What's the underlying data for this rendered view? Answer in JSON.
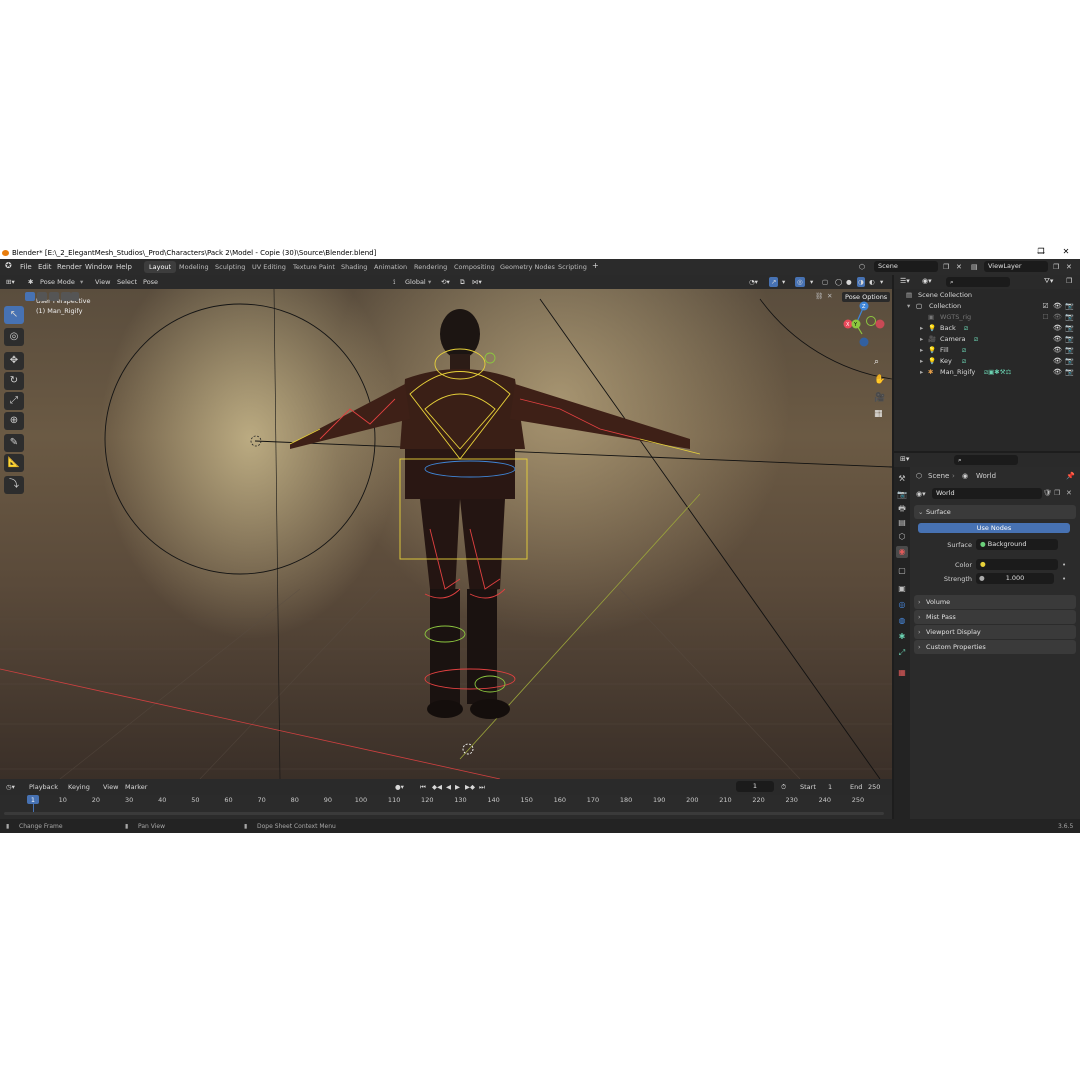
{
  "window": {
    "title": "Blender* [E:\\_2_ElegantMesh_Studios\\_Prod\\Characters\\Pack 2\\Model - Copie (30)\\Source\\Blender.blend]",
    "controls": [
      "—",
      "❐",
      "✕"
    ]
  },
  "menubar": {
    "items": [
      "File",
      "Edit",
      "Render",
      "Window",
      "Help"
    ],
    "workspaces": [
      "Layout",
      "Modeling",
      "Sculpting",
      "UV Editing",
      "Texture Paint",
      "Shading",
      "Animation",
      "Rendering",
      "Compositing",
      "Geometry Nodes",
      "Scripting"
    ],
    "active_workspace": "Layout",
    "add_tab": "+",
    "scene": "Scene",
    "view_layer": "ViewLayer"
  },
  "viewport_header": {
    "mode": "Pose Mode",
    "menus": [
      "View",
      "Select",
      "Pose"
    ],
    "transform_orientation": "Global",
    "pose_options": "Pose Options"
  },
  "viewport": {
    "perspective_label": "User Perspective",
    "object_label": "(1) Man_Rigify",
    "gizmo_axes": [
      "X",
      "Y",
      "Z"
    ]
  },
  "timeline": {
    "menus": [
      "Playback",
      "Keying",
      "View",
      "Marker"
    ],
    "current_frame": "1",
    "start_label": "Start",
    "start": "1",
    "end_label": "End",
    "end": "250",
    "ruler_ticks": [
      "1",
      "10",
      "20",
      "30",
      "40",
      "50",
      "60",
      "70",
      "80",
      "90",
      "100",
      "110",
      "120",
      "130",
      "140",
      "150",
      "160",
      "170",
      "180",
      "190",
      "200",
      "210",
      "220",
      "230",
      "240",
      "250"
    ]
  },
  "statusbar": {
    "left": "Change Frame",
    "middle": "Pan View",
    "right": "Dope Sheet Context Menu",
    "version": "3.6.5"
  },
  "outliner": {
    "root": "Scene Collection",
    "collection": "Collection",
    "items": [
      "WGTS_rig",
      "Back",
      "Camera",
      "Fill",
      "Key",
      "Man_Rigify"
    ]
  },
  "properties": {
    "breadcrumb_scene": "Scene",
    "breadcrumb_world": "World",
    "world_name": "World",
    "surface_panel": "Surface",
    "use_nodes": "Use Nodes",
    "surface_label": "Surface",
    "surface_value": "Background",
    "color_label": "Color",
    "strength_label": "Strength",
    "strength_value": "1.000",
    "panels": [
      "Volume",
      "Mist Pass",
      "Viewport Display",
      "Custom Properties"
    ]
  },
  "colors": {
    "accent": "#4772b3",
    "axis_x": "#e8495a",
    "axis_y": "#8cc63f",
    "axis_z": "#3f86d8",
    "bone_yellow": "#e8d23a"
  }
}
